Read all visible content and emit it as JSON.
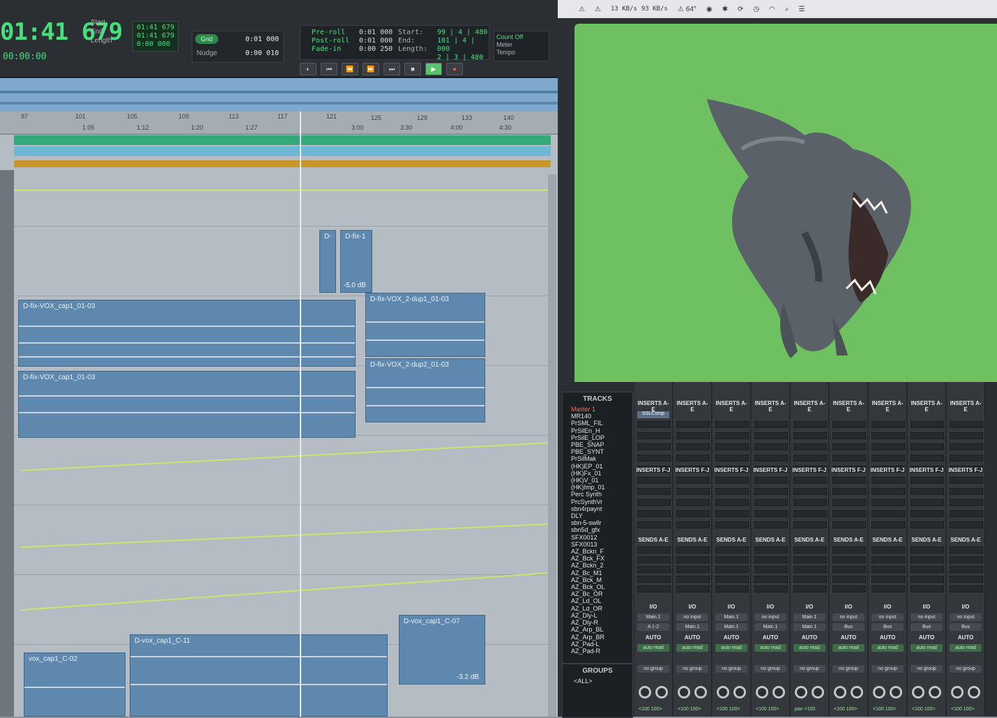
{
  "menubar": {
    "wifi_label": "",
    "net_up": "13 KB/s",
    "net_down": "93 KB/s",
    "temperature": "64°"
  },
  "transport": {
    "main_counter": "01:41 679",
    "sub_counter": "00:00:00",
    "counter_labels": [
      "Start",
      "End",
      "Length"
    ],
    "counter_values": [
      "01:41 679",
      "01:41 679",
      "0:00 000"
    ],
    "nudge_label": "Nudge",
    "nudge_value": "0:01 000",
    "grid_value": "0:00 010",
    "preroll_label": "Pre-roll",
    "postroll_label": "Post-roll",
    "fadein_label": "Fade-in",
    "preroll_value": "0:01 000",
    "postroll_value": "0:01 000",
    "fadein_value": "0:00 250",
    "start_label": "Start:",
    "end_label": "End:",
    "length_label": "Length:",
    "start_value": "99 | 4 | 480",
    "end_value": "101 | 4 | 000",
    "length_value": "2 | 3 | 480",
    "count_off": "Count Off",
    "meter_label": "Meter",
    "tempo_label": "Tempo"
  },
  "ruler": {
    "bars": [
      "97",
      "101",
      "105",
      "109",
      "113",
      "117",
      "121",
      "125",
      "129",
      "133",
      "140"
    ],
    "minsecs": [
      "1:05",
      "1:12",
      "1:20",
      "1:27",
      "3:00",
      "3:30",
      "4:00",
      "4:30"
    ]
  },
  "edit": {
    "clips": [
      {
        "name": "D-",
        "gain": ""
      },
      {
        "name": "D-fix-1",
        "gain": "-5.0 dB"
      },
      {
        "name": "D-fix-VOX_cap1_01-03",
        "gain": ""
      },
      {
        "name": "D-fix-VOX_2-dup1_01-03",
        "gain": ""
      },
      {
        "name": "D-fix-VOX_cap1_01-03",
        "gain": ""
      },
      {
        "name": "D-fix-VOX_2-dup2_01-03",
        "gain": ""
      },
      {
        "name": "vox_cap1_C-02",
        "gain": ""
      },
      {
        "name": "D-vox_cap1_C-11",
        "gain": ""
      },
      {
        "name": "D-vox_cap1_C-07",
        "gain": "-3.2 dB"
      }
    ]
  },
  "mix": {
    "tracks_header": "TRACKS",
    "tracks": [
      "Master 1",
      "MR140",
      "PrSML_FIL",
      "PrSilEn_H",
      "PrSilE_LOP",
      "PBE_SNAP",
      "PBE_SYNT",
      "PrSilMak",
      "(HK)EP_01",
      "(HK)Fx_01",
      "(HK)V_01",
      "(HK)Imp_01",
      "Perc Synth",
      "PrcSynthVr",
      "sbn4rpaynt",
      "DLY",
      "sbn-5-swllr",
      "sbn5d_gfx",
      "SFX0012",
      "SFX0013",
      "AZ_Bckn_F",
      "AZ_Bck_FX",
      "AZ_Bckn_2",
      "AZ_Bc_M1",
      "AZ_Bck_M",
      "AZ_Bck_OL",
      "AZ_Bc_OR",
      "AZ_Ld_OL",
      "AZ_Ld_OR",
      "AZ_Dly-L",
      "AZ_Dly-R",
      "AZ_Arp_BL",
      "AZ_Arp_BR",
      "AZ_Pad-L",
      "AZ_Pad-R"
    ],
    "groups_header": "GROUPS",
    "groups": [
      "<ALL>"
    ],
    "inserts_ae": "INSERTS A-E",
    "inserts_fj": "INSERTS F-J",
    "sends_ae": "SENDS A-E",
    "io": "I/O",
    "auto": "AUTO",
    "plugin_first": "SSLComp",
    "io_in": [
      "Main.1",
      "no input",
      "Main.1",
      "no input",
      "Main.1",
      "no input",
      "no input",
      "no input",
      "no input"
    ],
    "io_out": [
      "A 1-2",
      "Main.1",
      "Main.1",
      "Main.1",
      "Main.1",
      "Bus",
      "Bus",
      "Bus",
      "Bus"
    ],
    "auto_mode": [
      "auto read",
      "auto read",
      "auto read",
      "auto read",
      "auto read",
      "auto read",
      "auto read",
      "auto read",
      "auto read"
    ],
    "group": [
      "no group",
      "no group",
      "no group",
      "no group",
      "no group",
      "no group",
      "no group",
      "no group",
      "no group"
    ],
    "pan": [
      "<100 100>",
      "<100 100>",
      "<100 100>",
      "<100 100>",
      "pan <100",
      "<100 100>",
      "<100 100>",
      "<100 100>",
      "<100 100>"
    ]
  }
}
